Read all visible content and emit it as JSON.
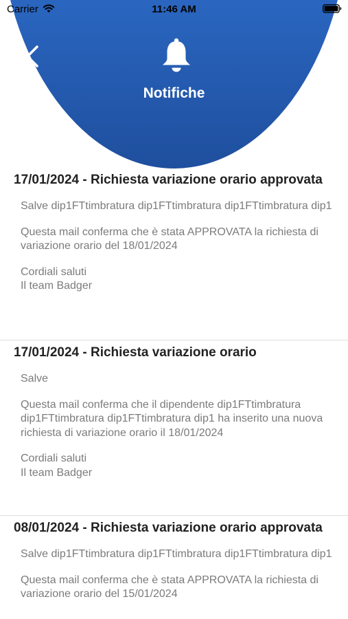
{
  "status_bar": {
    "carrier": "Carrier",
    "time": "11:46 AM"
  },
  "header": {
    "title": "Notifiche",
    "back_icon": "chevron-left-icon",
    "bell_icon": "bell-icon",
    "gradient_top": "#3a86dc",
    "gradient_bottom": "#1f4f9e"
  },
  "notifications": [
    {
      "title": "17/01/2024 - Richiesta variazione orario approvata",
      "paragraphs": [
        "Salve dip1FTtimbratura dip1FTtimbratura dip1FTtimbratura dip1",
        "Questa mail conferma che è stata APPROVATA la richiesta di variazione orario del 18/01/2024",
        "Cordiali saluti\nIl team Badger"
      ]
    },
    {
      "title": "17/01/2024 - Richiesta variazione orario",
      "paragraphs": [
        "Salve",
        "Questa mail conferma che il dipendente dip1FTtimbratura dip1FTtimbratura dip1FTtimbratura dip1 ha inserito una nuova richiesta di variazione orario il 18/01/2024",
        "Cordiali saluti\nIl team Badger"
      ]
    },
    {
      "title": "08/01/2024 - Richiesta variazione orario approvata",
      "paragraphs": [
        "Salve dip1FTtimbratura dip1FTtimbratura dip1FTtimbratura dip1",
        "Questa mail conferma che è stata APPROVATA la richiesta di variazione orario del 15/01/2024"
      ]
    }
  ]
}
